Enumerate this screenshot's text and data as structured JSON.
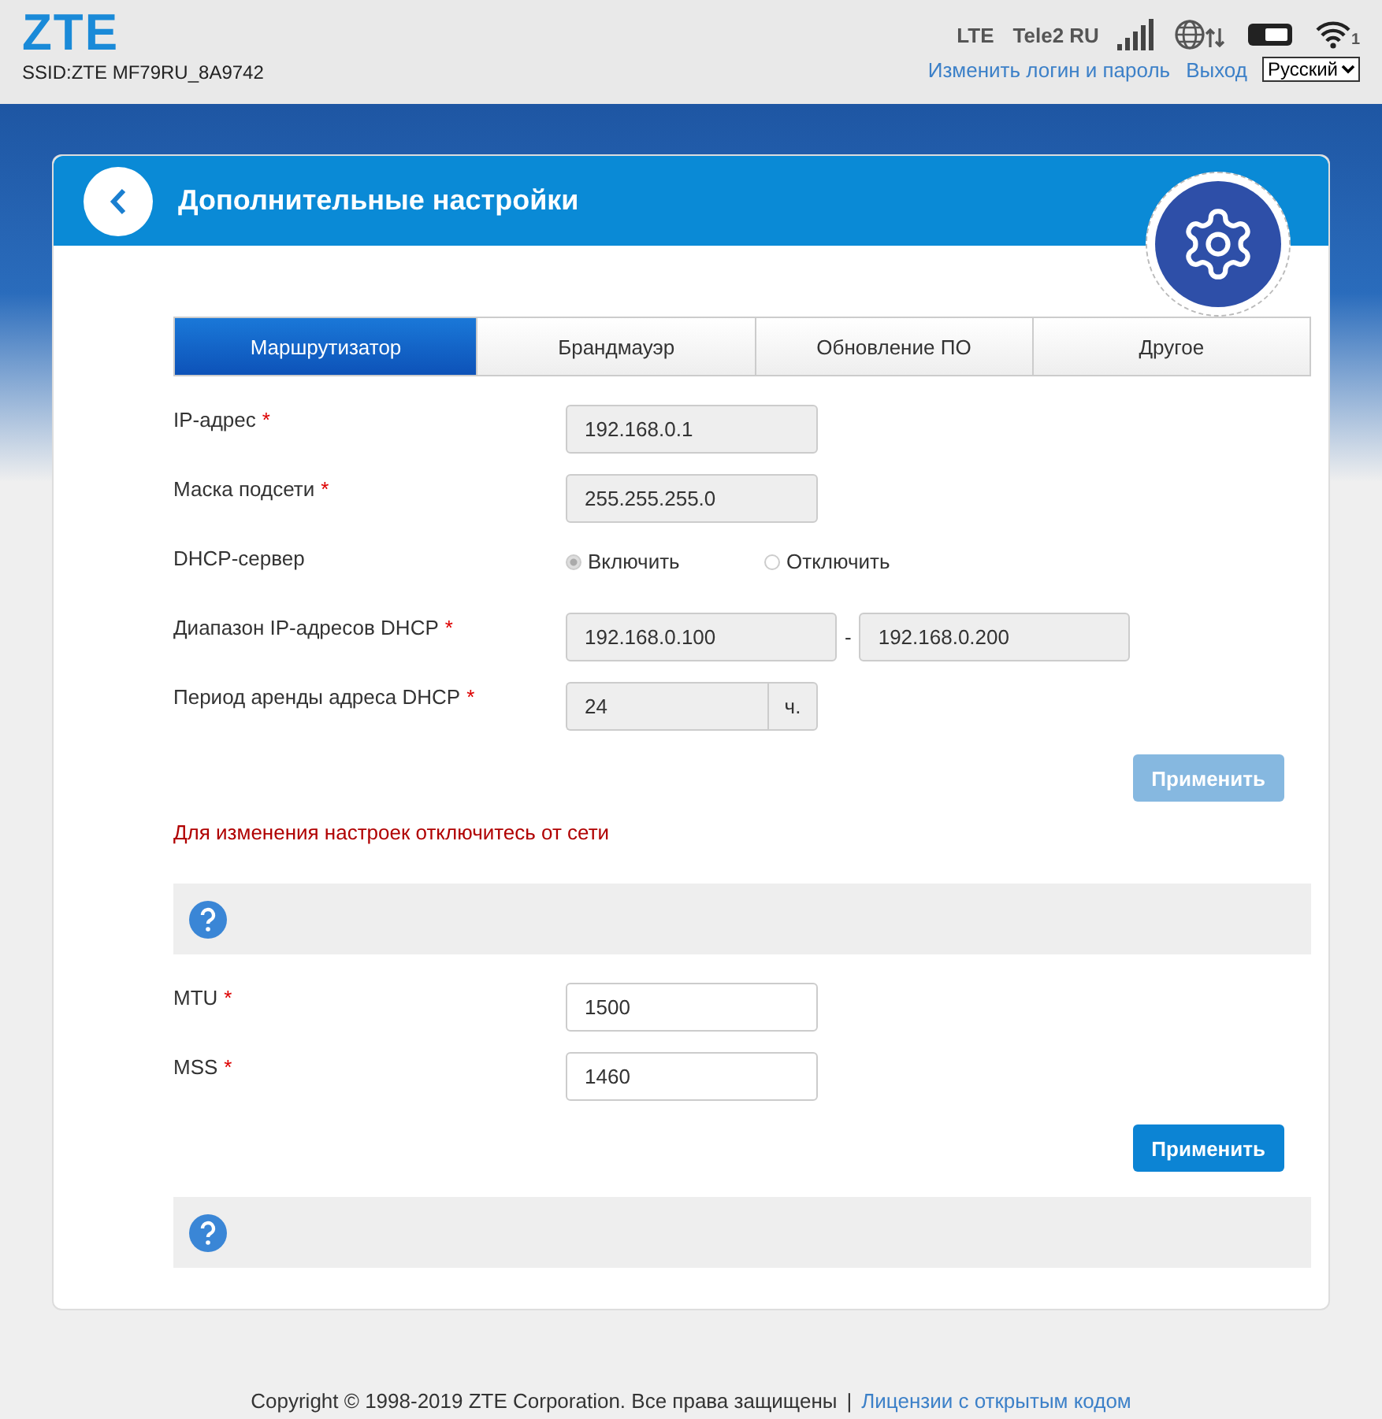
{
  "header": {
    "logo": "ZTE",
    "ssid": "SSID:ZTE MF79RU_8A9742",
    "network_type": "LTE",
    "operator": "Tele2 RU",
    "wifi_clients": "1",
    "links": [
      "Изменить логин и пароль",
      "Выход"
    ],
    "language": "Русский"
  },
  "page": {
    "title": "Дополнительные настройки"
  },
  "tabs": [
    {
      "label": "Маршрутизатор",
      "selected": true
    },
    {
      "label": "Брандмауэр",
      "selected": false
    },
    {
      "label": "Обновление ПО",
      "selected": false
    },
    {
      "label": "Другое",
      "selected": false
    }
  ],
  "lan_form": {
    "rows": [
      {
        "kind": "input",
        "label": "IP-адрес",
        "required_mark": "*",
        "value": "192.168.0.1",
        "disabled": true
      },
      {
        "kind": "input",
        "label": "Маска подсети",
        "required_mark": "*",
        "value": "255.255.255.0",
        "disabled": true
      },
      {
        "kind": "radio",
        "label": "DHCP-сервер",
        "disabled": true,
        "options": [
          {
            "label": "Включить",
            "selected": true
          },
          {
            "label": "Отключить",
            "selected": false
          }
        ]
      },
      {
        "kind": "range",
        "label": "Диапазон IP-адресов DHCP",
        "required_mark": "*",
        "value": "192.168.0.100",
        "separator": "-",
        "value_end": "192.168.0.200",
        "disabled": true
      },
      {
        "kind": "unit",
        "label": "Период аренды адреса DHCP",
        "required_mark": "*",
        "value": "24",
        "unit": "ч.",
        "disabled": true
      }
    ],
    "apply_button": {
      "label": "Применить",
      "disabled": true
    },
    "warning": "Для изменения настроек отключитесь от сети"
  },
  "mtu_form": {
    "rows": [
      {
        "kind": "input",
        "label": "MTU",
        "required_mark": "*",
        "value": "1500",
        "disabled": false
      },
      {
        "kind": "input",
        "label": "MSS",
        "required_mark": "*",
        "value": "1460",
        "disabled": false
      }
    ],
    "apply_button": {
      "label": "Применить",
      "disabled": false
    }
  },
  "footer": {
    "copyright": "Copyright © 1998-2019 ZTE Corporation. Все права защищены",
    "separator": "|",
    "link": "Лицензии с открытым кодом"
  }
}
